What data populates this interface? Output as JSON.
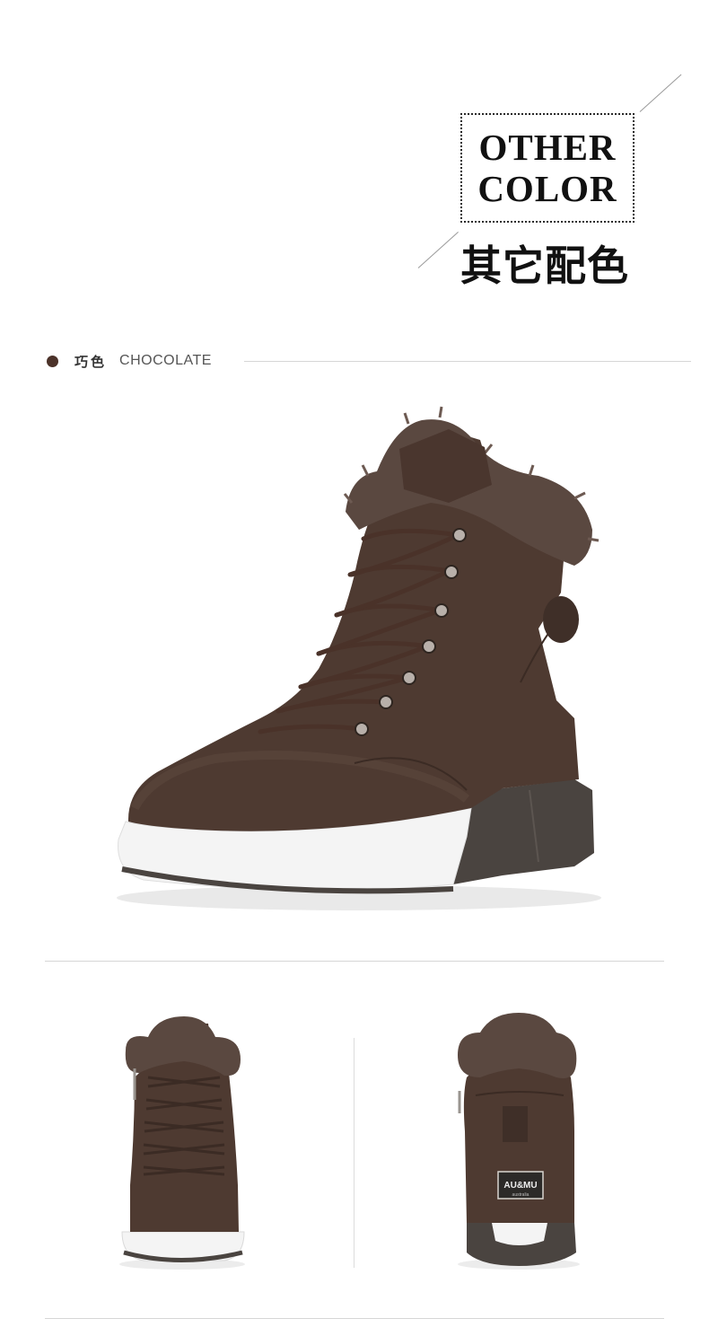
{
  "header": {
    "title_line1": "OTHER",
    "title_line2": "COLOR",
    "title_cn": "其它配色"
  },
  "color_label": {
    "name_cn": "巧色",
    "name_en": "CHOCOLATE",
    "swatch": "#4b3229"
  },
  "product": {
    "brand_label": "AU&MU",
    "brand_sub": "australia",
    "colors": {
      "suede": "#4e3a31",
      "suede_dark": "#3b2b24",
      "fur": "#5a4840",
      "sole_white": "#f4f4f4",
      "sole_dark": "#4a4440"
    },
    "views": [
      "side-view",
      "front-view",
      "back-view"
    ]
  }
}
